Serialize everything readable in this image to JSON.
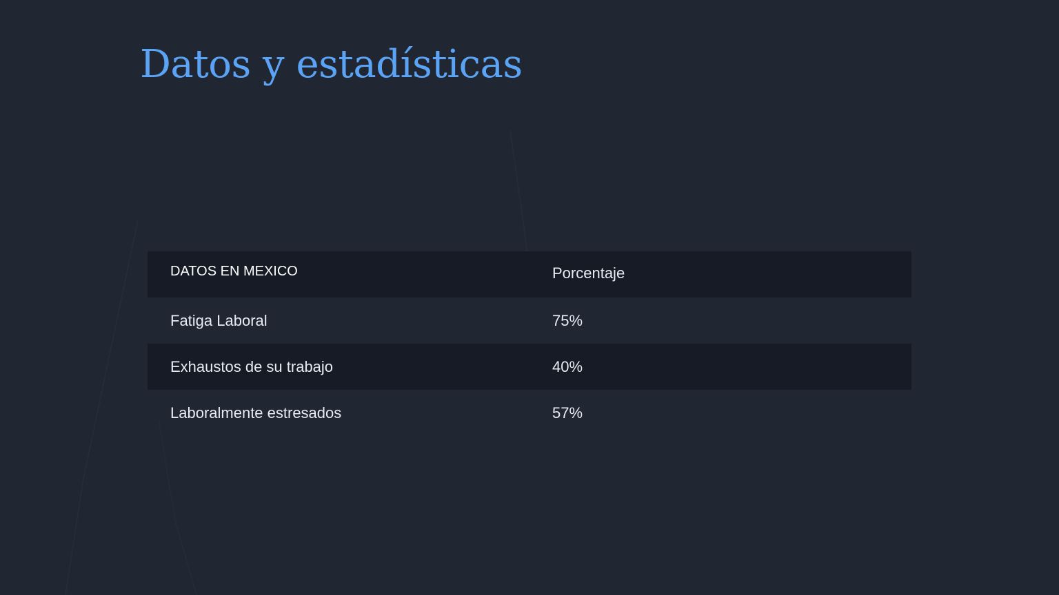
{
  "slide": {
    "title": "Datos y estadísticas",
    "colors": {
      "background": "#212633",
      "title": "#5ba3f5",
      "row_shade": "#171b26",
      "text": "#e8ebf1"
    }
  },
  "table": {
    "headers": [
      "DATOS EN MEXICO",
      "Porcentaje"
    ],
    "rows": [
      [
        "Fatiga Laboral",
        "75%"
      ],
      [
        "Exhaustos de su trabajo",
        "40%"
      ],
      [
        "Laboralmente estresados",
        "57%"
      ]
    ]
  }
}
